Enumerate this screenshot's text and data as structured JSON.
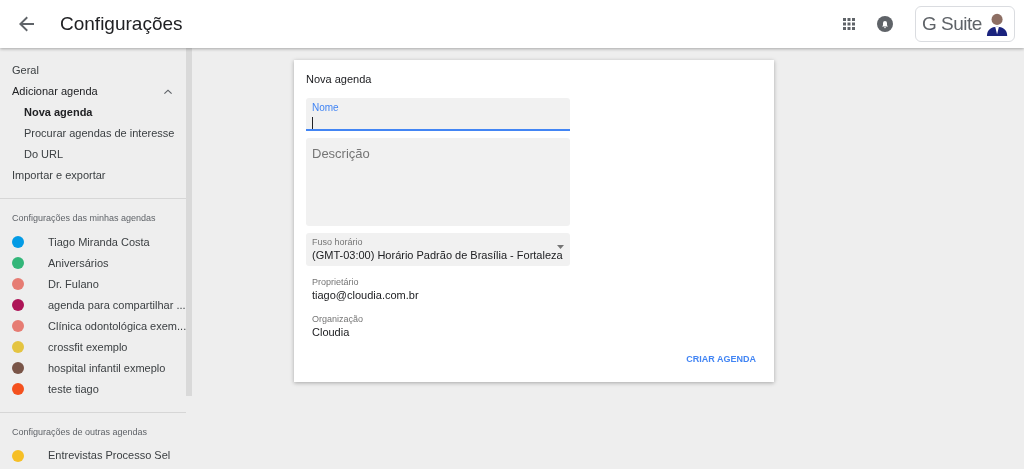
{
  "header": {
    "title": "Configurações",
    "brand": "G Suite"
  },
  "sidebar": {
    "items": [
      {
        "label": "Geral",
        "selected": false
      },
      {
        "label": "Adicionar agenda",
        "selected": false,
        "expanded": true,
        "children": [
          {
            "label": "Nova agenda",
            "selected": true
          },
          {
            "label": "Procurar agendas de interesse",
            "selected": false
          },
          {
            "label": "Do URL",
            "selected": false
          }
        ]
      },
      {
        "label": "Importar e exportar",
        "selected": false
      }
    ],
    "my_calendars": {
      "heading": "Configurações das minhas agendas",
      "items": [
        {
          "label": "Tiago Miranda Costa",
          "color": "#039be5"
        },
        {
          "label": "Aniversários",
          "color": "#33b679"
        },
        {
          "label": "Dr. Fulano",
          "color": "#e67c73"
        },
        {
          "label": "agenda para compartilhar ...",
          "color": "#ad1457"
        },
        {
          "label": "Clínica odontológica exem...",
          "color": "#e67c73"
        },
        {
          "label": "crossfit exemplo",
          "color": "#e4c441"
        },
        {
          "label": "hospital infantil exmeplo",
          "color": "#795548"
        },
        {
          "label": "teste tiago",
          "color": "#f4511e"
        }
      ]
    },
    "other_calendars": {
      "heading": "Configurações de outras agendas",
      "items": [
        {
          "label": "Entrevistas Processo Sel",
          "color": "#f6bf26"
        }
      ]
    }
  },
  "form": {
    "title": "Nova agenda",
    "name_field": {
      "label": "Nome",
      "focused": true
    },
    "description_field": {
      "placeholder": "Descrição"
    },
    "timezone": {
      "label": "Fuso horário",
      "value": "(GMT-03:00) Horário Padrão de Brasília - Fortaleza"
    },
    "owner": {
      "label": "Proprietário",
      "value": "tiago@cloudia.com.br"
    },
    "organization": {
      "label": "Organização",
      "value": "Cloudia"
    },
    "submit": "CRIAR AGENDA"
  }
}
